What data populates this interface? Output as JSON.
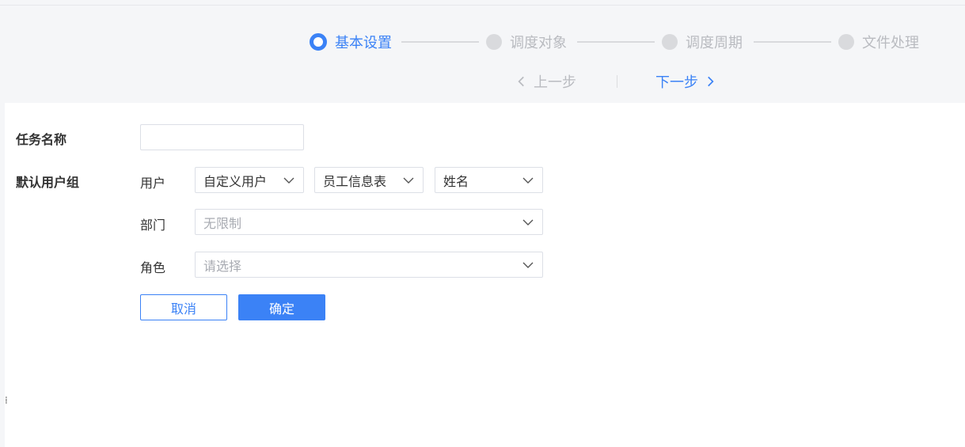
{
  "steps": [
    {
      "label": "基本设置",
      "state": "active"
    },
    {
      "label": "调度对象",
      "state": "inactive"
    },
    {
      "label": "调度周期",
      "state": "inactive"
    },
    {
      "label": "文件处理",
      "state": "inactive"
    }
  ],
  "nav": {
    "prev": "上一步",
    "next": "下一步"
  },
  "form": {
    "task_name_label": "任务名称",
    "task_name_value": "",
    "user_group_label": "默认用户组",
    "user_label": "用户",
    "user_select_1": "自定义用户",
    "user_select_2": "员工信息表",
    "user_select_3": "姓名",
    "dept_label": "部门",
    "dept_placeholder": "无限制",
    "role_label": "角色",
    "role_placeholder": "请选择"
  },
  "buttons": {
    "cancel": "取消",
    "ok": "确定"
  },
  "colors": {
    "accent": "#3b82f6",
    "inactive": "#b9bbc0",
    "background": "#f5f6f8"
  },
  "icons": {
    "dropdown": "chevron-down-icon",
    "prev": "chevron-left-icon",
    "next": "chevron-right-icon"
  }
}
